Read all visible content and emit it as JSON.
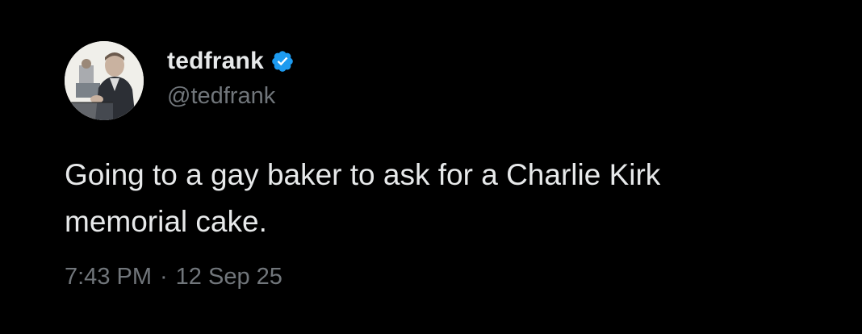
{
  "tweet": {
    "display_name": "tedfrank",
    "handle": "@tedfrank",
    "verified": true,
    "avatar_icon": "courtroom-sketch-avatar",
    "text": "Going to a gay baker to ask for a Charlie Kirk\nmemorial cake.",
    "time": "7:43 PM",
    "separator": "·",
    "date": "12 Sep 25"
  },
  "colors": {
    "background": "#000000",
    "primary_text": "#e7e9ea",
    "secondary_text": "#71767b",
    "verified_badge": "#1d9bf0"
  }
}
